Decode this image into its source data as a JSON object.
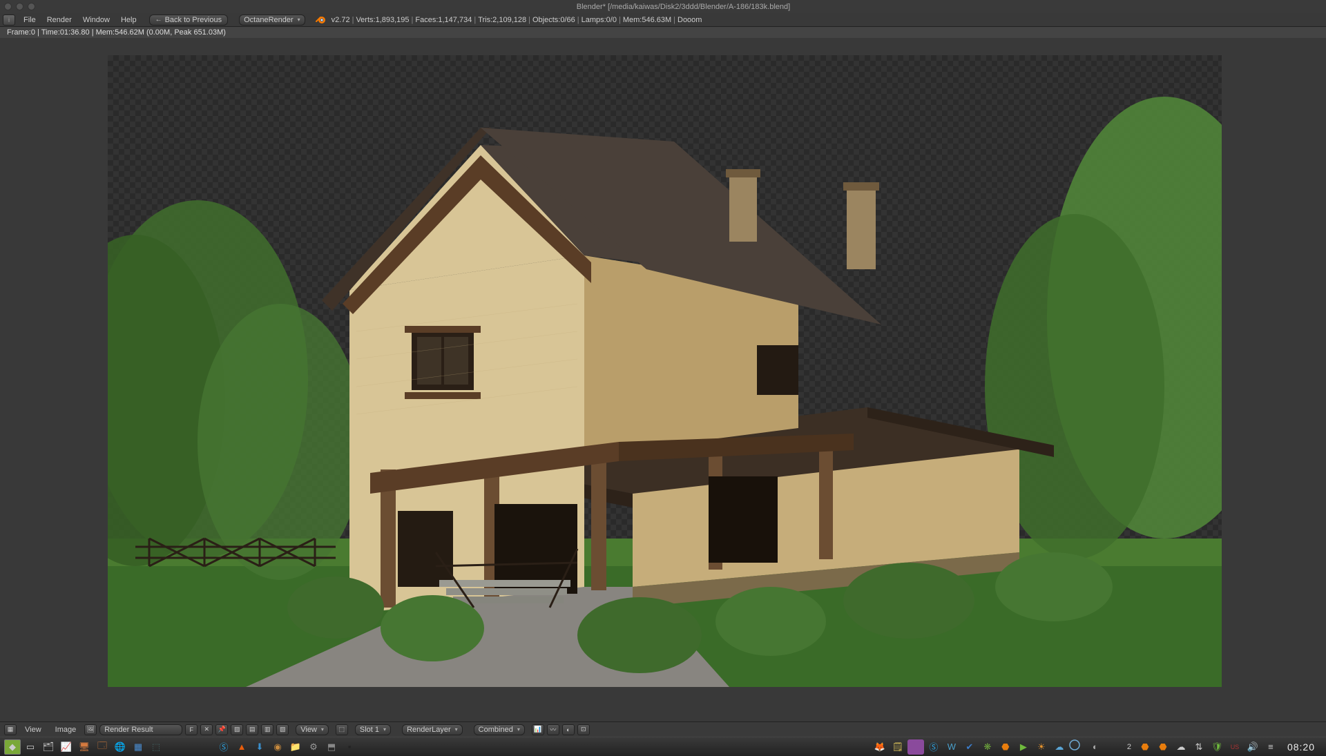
{
  "app": {
    "title": "Blender* [/media/kaiwas/Disk2/3ddd/Blender/A-186/183k.blend]",
    "version": "v2.72"
  },
  "menu": {
    "file": "File",
    "render": "Render",
    "window": "Window",
    "help": "Help"
  },
  "header": {
    "back": "Back to Previous",
    "engine": "OctaneRender",
    "stats": {
      "verts": "Verts:1,893,195",
      "faces": "Faces:1,147,734",
      "tris": "Tris:2,109,128",
      "objects": "Objects:0/66",
      "lamps": "Lamps:0/0",
      "mem": "Mem:546.63M",
      "scene": "Dooom"
    }
  },
  "render_stats": "Frame:0 | Time:01:36.80 | Mem:546.62M (0.00M, Peak 651.03M)",
  "image_editor": {
    "view": "View",
    "image": "Image",
    "result": "Render Result",
    "pin": "F",
    "view_dd": "View",
    "slot": "Slot 1",
    "layer": "RenderLayer",
    "pass": "Combined"
  },
  "taskbar": {
    "clock": "08:20",
    "workspace_count": "2"
  }
}
